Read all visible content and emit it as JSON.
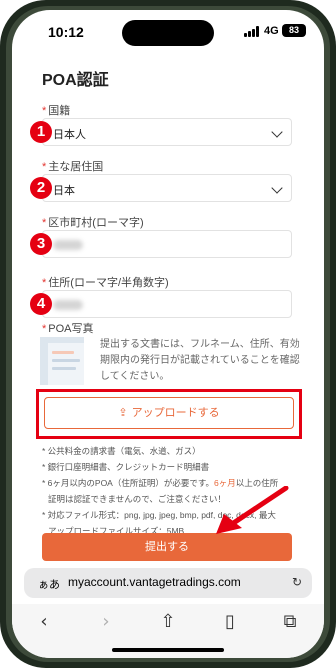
{
  "status_bar": {
    "time": "10:12",
    "network": "4G",
    "battery": "83"
  },
  "page": {
    "title": "POA認証"
  },
  "fields": {
    "nationality": {
      "label": "国籍",
      "value": "日本人",
      "badge": "1"
    },
    "residence": {
      "label": "主な居住国",
      "value": "日本",
      "badge": "2"
    },
    "city": {
      "label": "区市町村(ローマ字)",
      "badge": "3"
    },
    "address": {
      "label": "住所(ローマ字/半角数字)",
      "badge": "4"
    }
  },
  "poa": {
    "label": "POA写真",
    "description": "提出する文書には、フルネーム、住所、有効期限内の発行日が記載されていることを確認してください。",
    "upload_label": "アップロードする"
  },
  "notes": {
    "item1": "* 公共料金の請求書（電気、水道、ガス）",
    "item2": "* 銀行口座明細書、クレジットカード明細書",
    "item3_pre": "* 6ヶ月以内のPOA（住所証明）が必要です。",
    "item3_hl": "6ヶ月",
    "item3_post": "以上の住所",
    "item3_line2": "証明は認証できませんので、ご注意ください！",
    "item4": "* 対応ファイル形式：png, jpg, jpeg, bmp, pdf, doc, docx, 最大",
    "item5": "アップロードファイルサイズ：5MB"
  },
  "submit_label": "提出する",
  "browser": {
    "aa": "ぁあ",
    "url": "myaccount.vantagetradings.com"
  },
  "colors": {
    "accent": "#e8683a",
    "highlight_red": "#e50012"
  },
  "icons": {
    "upload": "upload-icon",
    "back": "chevron-left-icon",
    "forward": "chevron-right-icon",
    "share": "share-icon",
    "bookmarks": "book-icon",
    "tabs": "tabs-icon",
    "reload": "reload-icon"
  }
}
